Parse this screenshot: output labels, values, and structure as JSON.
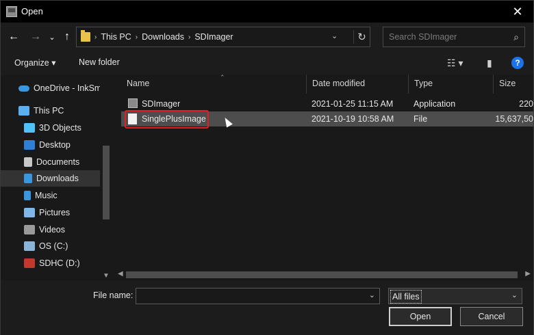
{
  "window": {
    "title": "Open",
    "close_glyph": "✕"
  },
  "nav": {
    "back": "←",
    "forward": "→",
    "recent": "⌄",
    "up": "↑",
    "breadcrumb": [
      "This PC",
      "Downloads",
      "SDImager"
    ],
    "separator": "›",
    "dropdown": "⌄",
    "refresh": "↻",
    "search_placeholder": "Search SDImager",
    "search_icon": "⌕"
  },
  "toolbar": {
    "organize_label": "Organize ▾",
    "new_folder_label": "New folder",
    "view_icon": "☷ ▾",
    "pane_icon": "▮",
    "help_label": "?"
  },
  "sidebar": {
    "items": [
      {
        "label": "OneDrive - InkSm",
        "icon": "cloud-icon",
        "color": "#3a96dd"
      },
      {
        "label": "This PC",
        "icon": "computer-icon",
        "color": "#5ab0f0"
      },
      {
        "label": "3D Objects",
        "icon": "cube-icon",
        "color": "#4fc3f7"
      },
      {
        "label": "Desktop",
        "icon": "desktop-icon",
        "color": "#2f7fd4"
      },
      {
        "label": "Documents",
        "icon": "document-icon",
        "color": "#c7c7c7"
      },
      {
        "label": "Downloads",
        "icon": "download-icon",
        "color": "#3a96dd"
      },
      {
        "label": "Music",
        "icon": "music-icon",
        "color": "#3a96dd"
      },
      {
        "label": "Pictures",
        "icon": "pictures-icon",
        "color": "#7fb7e8"
      },
      {
        "label": "Videos",
        "icon": "video-icon",
        "color": "#9a9a9a"
      },
      {
        "label": "OS (C:)",
        "icon": "drive-icon",
        "color": "#8ab4d8"
      },
      {
        "label": "SDHC (D:)",
        "icon": "sd-card-icon",
        "color": "#c0392b"
      }
    ],
    "selected": "Downloads"
  },
  "columns": [
    "Name",
    "Date modified",
    "Type",
    "Size"
  ],
  "files": [
    {
      "name": "SDImager",
      "date": "2021-01-25 11:15 AM",
      "type": "Application",
      "size": "220"
    },
    {
      "name": "SinglePlusImage",
      "date": "2021-10-19 10:58 AM",
      "type": "File",
      "size": "15,637,50"
    }
  ],
  "bottom": {
    "file_name_label": "File name:",
    "file_name_value": "",
    "filter_value": "All files",
    "open_label": "Open",
    "cancel_label": "Cancel",
    "dropdown": "⌄"
  }
}
